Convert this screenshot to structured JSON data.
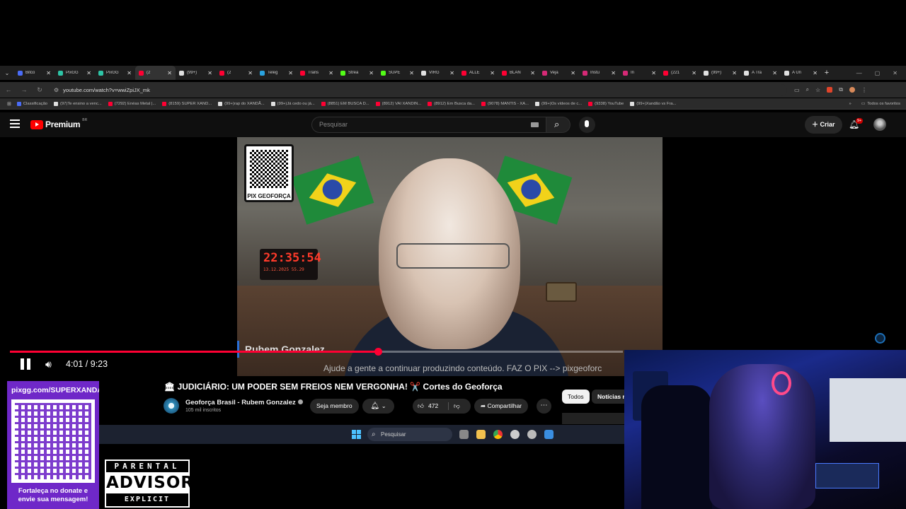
{
  "browser": {
    "tabs": [
      {
        "label": "Bitco",
        "color": "#4a6cf7"
      },
      {
        "label": "PixGG",
        "color": "#2ec4a6"
      },
      {
        "label": "PixGG",
        "color": "#2ec4a6"
      },
      {
        "label": "(2",
        "color": "#ff0033",
        "active": true
      },
      {
        "label": "(99+)",
        "color": "#e0e0e0"
      },
      {
        "label": "(2",
        "color": "#ff0033"
      },
      {
        "label": "Teleg",
        "color": "#2aa3e0"
      },
      {
        "label": "Trans",
        "color": "#ff0033"
      },
      {
        "label": "Strea",
        "color": "#53fc18"
      },
      {
        "label": "SUPE",
        "color": "#53fc18"
      },
      {
        "label": "VIRG",
        "color": "#e0e0e0"
      },
      {
        "label": "ALLE",
        "color": "#ff0033"
      },
      {
        "label": "BLAN",
        "color": "#ff0033"
      },
      {
        "label": "Veja",
        "color": "#d62976"
      },
      {
        "label": "Instu",
        "color": "#d62976"
      },
      {
        "label": "In",
        "color": "#d62976"
      },
      {
        "label": "(221",
        "color": "#ff0033"
      },
      {
        "label": "(99+)",
        "color": "#e0e0e0"
      },
      {
        "label": "A Tra",
        "color": "#e0e0e0"
      },
      {
        "label": "A Ún",
        "color": "#e0e0e0"
      }
    ],
    "new_tab": "+",
    "url": "youtube.com/watch?v=wwiZpiJX_mk",
    "bookmarks": [
      {
        "label": "Classificação",
        "color": "#4a6cf7"
      },
      {
        "label": "(97)Te ensino a venc...",
        "color": "#e0e0e0"
      },
      {
        "label": "(7292) Enéas Metal |...",
        "color": "#ff0033"
      },
      {
        "label": "(8159) SUPER XAND...",
        "color": "#ff0033"
      },
      {
        "label": "(99+)rap do XANDÃ...",
        "color": "#e0e0e0"
      },
      {
        "label": "(99+)Já cedo ou já...",
        "color": "#e0e0e0"
      },
      {
        "label": "(8851) EM BUSCA D...",
        "color": "#ff0033"
      },
      {
        "label": "(8912) VAI XANDIN...",
        "color": "#ff0033"
      },
      {
        "label": "(8912) Em Busca da...",
        "color": "#ff0033"
      },
      {
        "label": "(9078) MANTIS - XA...",
        "color": "#ff0033"
      },
      {
        "label": "(99+)Os vídeos de c...",
        "color": "#e0e0e0"
      },
      {
        "label": "(9338) YouTube",
        "color": "#ff0033"
      },
      {
        "label": "(99+)Xandão vs Fra...",
        "color": "#e0e0e0"
      }
    ],
    "all_bookmarks": "Todos os favoritos"
  },
  "youtube": {
    "logo_text": "Premium",
    "logo_region": "BR",
    "search_placeholder": "Pesquisar",
    "create_label": "Criar",
    "notification_badge": "9+",
    "video_title": "JUDICIÁRIO: UM PODER SEM FREIOS NEM VERGONHA! ✂️ Cortes do Geoforça",
    "channel_name": "Geoforça Brasil - Rubem Gonzalez",
    "subscribers": "105 mil inscritos",
    "join_label": "Seja membro",
    "likes": "472",
    "share_label": "Compartilhar",
    "chips": [
      "Todos",
      "Notícias r"
    ]
  },
  "player": {
    "current_time": "4:01",
    "duration": "9:23",
    "time_display": "4:01 / 9:23",
    "progress_fraction": 0.6,
    "subtitle": "Ajude a gente a continuar produzindo conteúdo. FAZ O PIX --> pixgeoforc"
  },
  "video_frame": {
    "qr_label": "PIX GEOFORÇA",
    "clock_time": "22:35:54",
    "clock_date": "13.12.2025    55.29",
    "lower_third": "Rubem Gonzalez"
  },
  "taskbar": {
    "search_label": "Pesquisar"
  },
  "overlay": {
    "pix_url": "pixgg.com/SUPERXANDA",
    "pix_cta_line1": "Fortaleça no donate e",
    "pix_cta_line2": "envie sua mensagem!",
    "advisory_top": "PARENTAL",
    "advisory_mid": "ADVISORY",
    "advisory_bottom": "EXPLICIT CONTENT"
  }
}
